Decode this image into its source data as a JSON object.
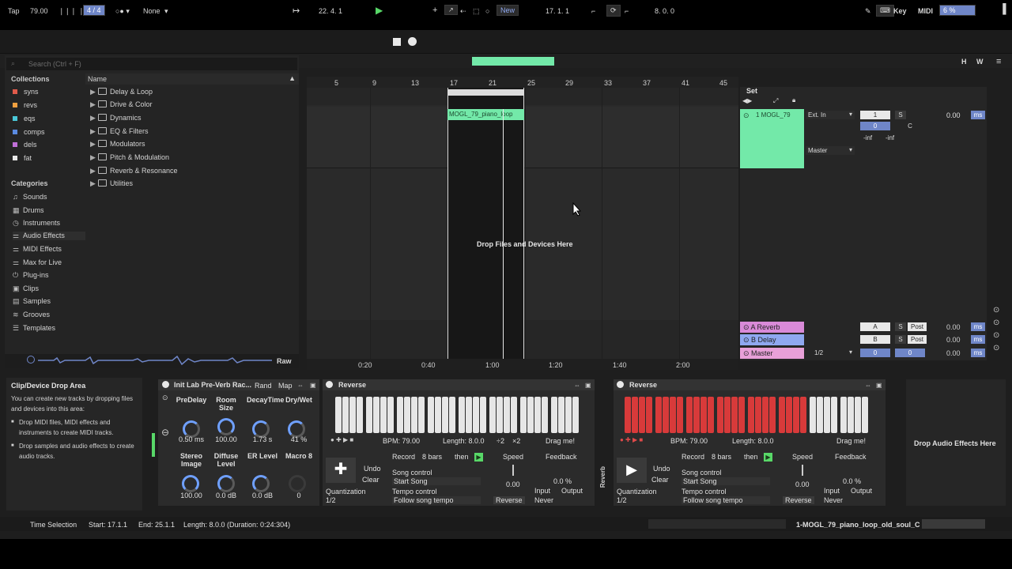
{
  "transport": {
    "tap": "Tap",
    "bpm": "79.00",
    "signature": "4 / 4",
    "groove": "None",
    "position": "22.  4.  1",
    "new_label": "New",
    "loop_start": "17.  1.  1",
    "loop_length": "8.  0.  0",
    "key": "Key",
    "midi": "MIDI",
    "cpu": "6 %",
    "h": "H",
    "w": "W"
  },
  "browser": {
    "search_placeholder": "Search (Ctrl + F)",
    "collections_title": "Collections",
    "collections": [
      {
        "label": "syns",
        "color": "#e05a4a"
      },
      {
        "label": "revs",
        "color": "#f0a040"
      },
      {
        "label": "eqs",
        "color": "#4ac8d8"
      },
      {
        "label": "comps",
        "color": "#5a8ae0"
      },
      {
        "label": "dels",
        "color": "#c070d8"
      },
      {
        "label": "fat",
        "color": "#e8e8e8"
      }
    ],
    "categories_title": "Categories",
    "categories": [
      "Sounds",
      "Drums",
      "Instruments",
      "Audio Effects",
      "MIDI Effects",
      "Max for Live",
      "Plug-ins",
      "Clips",
      "Samples",
      "Grooves",
      "Templates"
    ],
    "name_header": "Name",
    "folders": [
      "Delay & Loop",
      "Drive & Color",
      "Dynamics",
      "EQ & Filters",
      "Modulators",
      "Pitch & Modulation",
      "Reverb & Resonance",
      "Utilities"
    ],
    "raw": "Raw"
  },
  "arrangement": {
    "bars": [
      "5",
      "9",
      "13",
      "17",
      "21",
      "25",
      "29",
      "33",
      "37",
      "41",
      "45"
    ],
    "clip_name": "MOGL_79_piano_loop",
    "drop_text": "Drop Files and Devices Here",
    "times": [
      "0:20",
      "0:40",
      "1:00",
      "1:20",
      "1:40",
      "2:00"
    ],
    "set_label": "Set"
  },
  "mixer": {
    "track_name": "1 MOGL_79",
    "input": "Ext. In",
    "output": "Master",
    "track_num": "1",
    "solo": "S",
    "pan": "C",
    "vol_value": "0",
    "inf1": "-inf",
    "inf2": "-inf",
    "vol_db": "0.00",
    "ms": "ms",
    "returns": [
      {
        "name": "A Reverb",
        "letter": "A",
        "db": "0.00",
        "color": "#d98ad8"
      },
      {
        "name": "B Delay",
        "letter": "B",
        "db": "0.00",
        "color": "#8fa8f0"
      },
      {
        "name": "Master",
        "letter": "1/2",
        "db": "0.00",
        "color": "#e8a0d8"
      }
    ],
    "post": "Post"
  },
  "info": {
    "title": "Clip/Device Drop Area",
    "body": "You can create new tracks by dropping files and devices into this area:",
    "bullet1": "Drop MIDI files, MIDI effects and instruments to create MIDI tracks.",
    "bullet2": "Drop samples and audio effects to create audio tracks."
  },
  "rack": {
    "title": "Init Lab Pre-Verb Rac...",
    "rand": "Rand",
    "map": "Map",
    "macros": [
      {
        "label": "PreDelay",
        "value": "0.50 ms"
      },
      {
        "label": "Room Size",
        "value": "100.00"
      },
      {
        "label": "DecayTime",
        "value": "1.73 s"
      },
      {
        "label": "Dry/Wet",
        "value": "41 %"
      },
      {
        "label": "Stereo Image",
        "value": "100.00"
      },
      {
        "label": "Diffuse Level",
        "value": "0.0 dB"
      },
      {
        "label": "ER Level",
        "value": "0.0 dB"
      },
      {
        "label": "Macro 8",
        "value": "0"
      }
    ]
  },
  "reverse1": {
    "title": "Reverse",
    "bpm": "BPM: 79.00",
    "length": "Length: 8.0.0",
    "div": "÷2",
    "mul": "×2",
    "drag": "Drag me!",
    "record": "Record",
    "bars": "8 bars",
    "then": "then",
    "undo": "Undo",
    "clear": "Clear",
    "song_control": "Song control",
    "start_song": "Start Song",
    "tempo_control": "Tempo control",
    "follow": "Follow song tempo",
    "quantization": "Quantization",
    "quant_value": "1/2",
    "speed": "Speed",
    "speed_value": "0.00",
    "feedback": "Feedback",
    "feedback_value": "0.0 %",
    "reverse_btn": "Reverse",
    "input": "Input",
    "output": "Output",
    "never": "Never"
  },
  "reverse2": {
    "title": "Reverse",
    "bpm": "BPM: 79.00",
    "length": "Length: 8.0.0",
    "drag": "Drag me!",
    "record": "Record",
    "bars": "8 bars",
    "then": "then",
    "undo": "Undo",
    "clear": "Clear",
    "song_control": "Song control",
    "start_song": "Start Song",
    "tempo_control": "Tempo control",
    "follow": "Follow song tempo",
    "quantization": "Quantization",
    "quant_value": "1/2",
    "speed": "Speed",
    "speed_value": "0.00",
    "feedback": "Feedback",
    "feedback_value": "0.0 %",
    "reverse_btn": "Reverse",
    "input": "Input",
    "output": "Output",
    "never": "Never"
  },
  "drop_audio": "Drop Audio Effects Here",
  "reverb_side": "Reverb",
  "status": {
    "mode": "Time Selection",
    "start": "Start: 17.1.1",
    "end": "End: 25.1.1",
    "length": "Length: 8.0.0 (Duration: 0:24:304)",
    "clip_name": "1-MOGL_79_piano_loop_old_soul_C"
  }
}
